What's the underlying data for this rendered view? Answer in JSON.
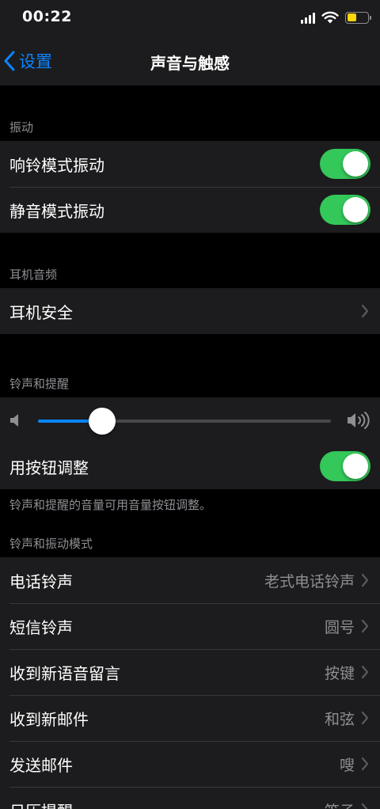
{
  "status_bar": {
    "time": "00:22"
  },
  "nav": {
    "back_label": "设置",
    "title": "声音与触感"
  },
  "vibration": {
    "header": "振动",
    "items": [
      {
        "label": "响铃模式振动",
        "on": true
      },
      {
        "label": "静音模式振动",
        "on": true
      }
    ]
  },
  "headphones": {
    "header": "耳机音频",
    "items": [
      {
        "label": "耳机安全"
      }
    ]
  },
  "ringer": {
    "header": "铃声和提醒",
    "volume_fraction": 0.22,
    "change_with_buttons_label": "用按钮调整",
    "change_with_buttons_on": true,
    "footer": "铃声和提醒的音量可用音量按钮调整。"
  },
  "sounds": {
    "header": "铃声和振动模式",
    "items": [
      {
        "label": "电话铃声",
        "value": "老式电话铃声"
      },
      {
        "label": "短信铃声",
        "value": "圆号"
      },
      {
        "label": "收到新语音留言",
        "value": "按键"
      },
      {
        "label": "收到新邮件",
        "value": "和弦"
      },
      {
        "label": "发送邮件",
        "value": "嗖"
      },
      {
        "label": "日历提醒",
        "value": "笛子"
      }
    ]
  },
  "colors": {
    "accent": "#0a84ff",
    "toggle_on": "#34c759",
    "background": "#000000",
    "cell": "#1c1c1e"
  }
}
